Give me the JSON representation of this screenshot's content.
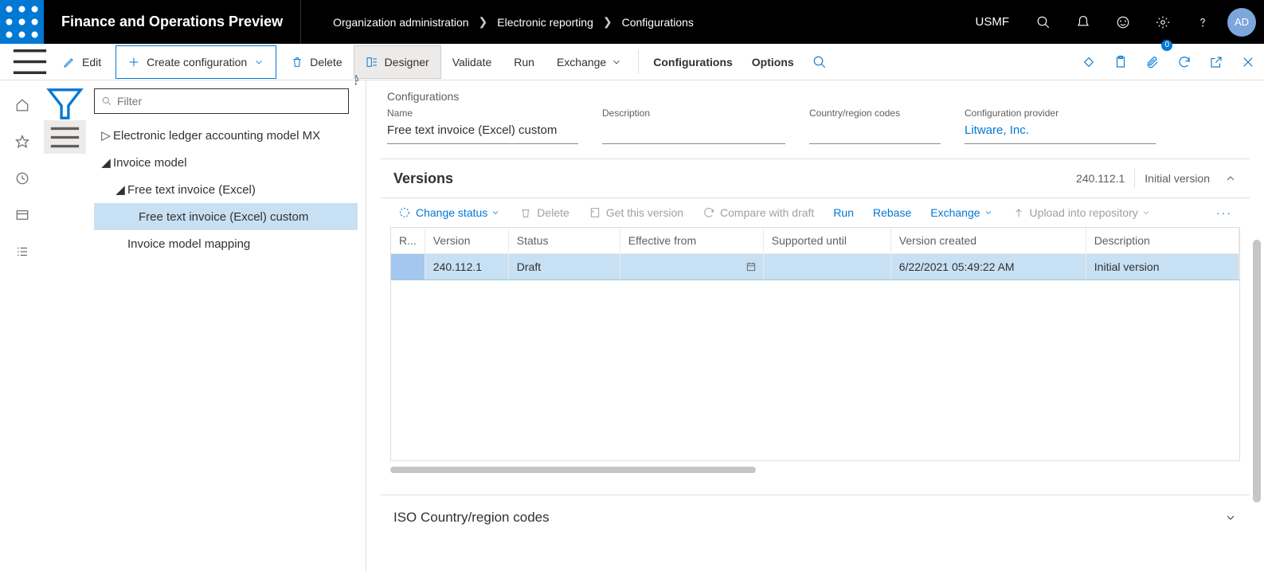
{
  "header": {
    "app_title": "Finance and Operations Preview",
    "breadcrumb": [
      "Organization administration",
      "Electronic reporting",
      "Configurations"
    ],
    "entity": "USMF",
    "avatar": "AD",
    "badge": "0"
  },
  "toolbar": {
    "edit": "Edit",
    "create": "Create configuration",
    "delete": "Delete",
    "designer": "Designer",
    "validate": "Validate",
    "run": "Run",
    "exchange": "Exchange",
    "configurations": "Configurations",
    "options": "Options"
  },
  "tree": {
    "filter_placeholder": "Filter",
    "items": [
      {
        "label": "Electronic ledger accounting model MX"
      },
      {
        "label": "Invoice model"
      },
      {
        "label": "Free text invoice (Excel)"
      },
      {
        "label": "Free text invoice (Excel) custom"
      },
      {
        "label": "Invoice model mapping"
      }
    ]
  },
  "detail": {
    "crumb": "Configurations",
    "fields": {
      "name_label": "Name",
      "name_value": "Free text invoice (Excel) custom",
      "desc_label": "Description",
      "desc_value": "",
      "country_label": "Country/region codes",
      "country_value": "",
      "provider_label": "Configuration provider",
      "provider_value": "Litware, Inc."
    },
    "versions": {
      "title": "Versions",
      "summary_version": "240.112.1",
      "summary_desc": "Initial version",
      "toolbar": {
        "change_status": "Change status",
        "delete": "Delete",
        "get_version": "Get this version",
        "compare": "Compare with draft",
        "run": "Run",
        "rebase": "Rebase",
        "exchange": "Exchange",
        "upload": "Upload into repository"
      },
      "columns": {
        "r": "R...",
        "version": "Version",
        "status": "Status",
        "effective": "Effective from",
        "supported": "Supported until",
        "created": "Version created",
        "desc": "Description"
      },
      "rows": [
        {
          "r": "",
          "version": "240.112.1",
          "status": "Draft",
          "effective": "",
          "supported": "",
          "created": "6/22/2021 05:49:22 AM",
          "desc": "Initial version"
        }
      ]
    },
    "iso_section": "ISO Country/region codes"
  }
}
